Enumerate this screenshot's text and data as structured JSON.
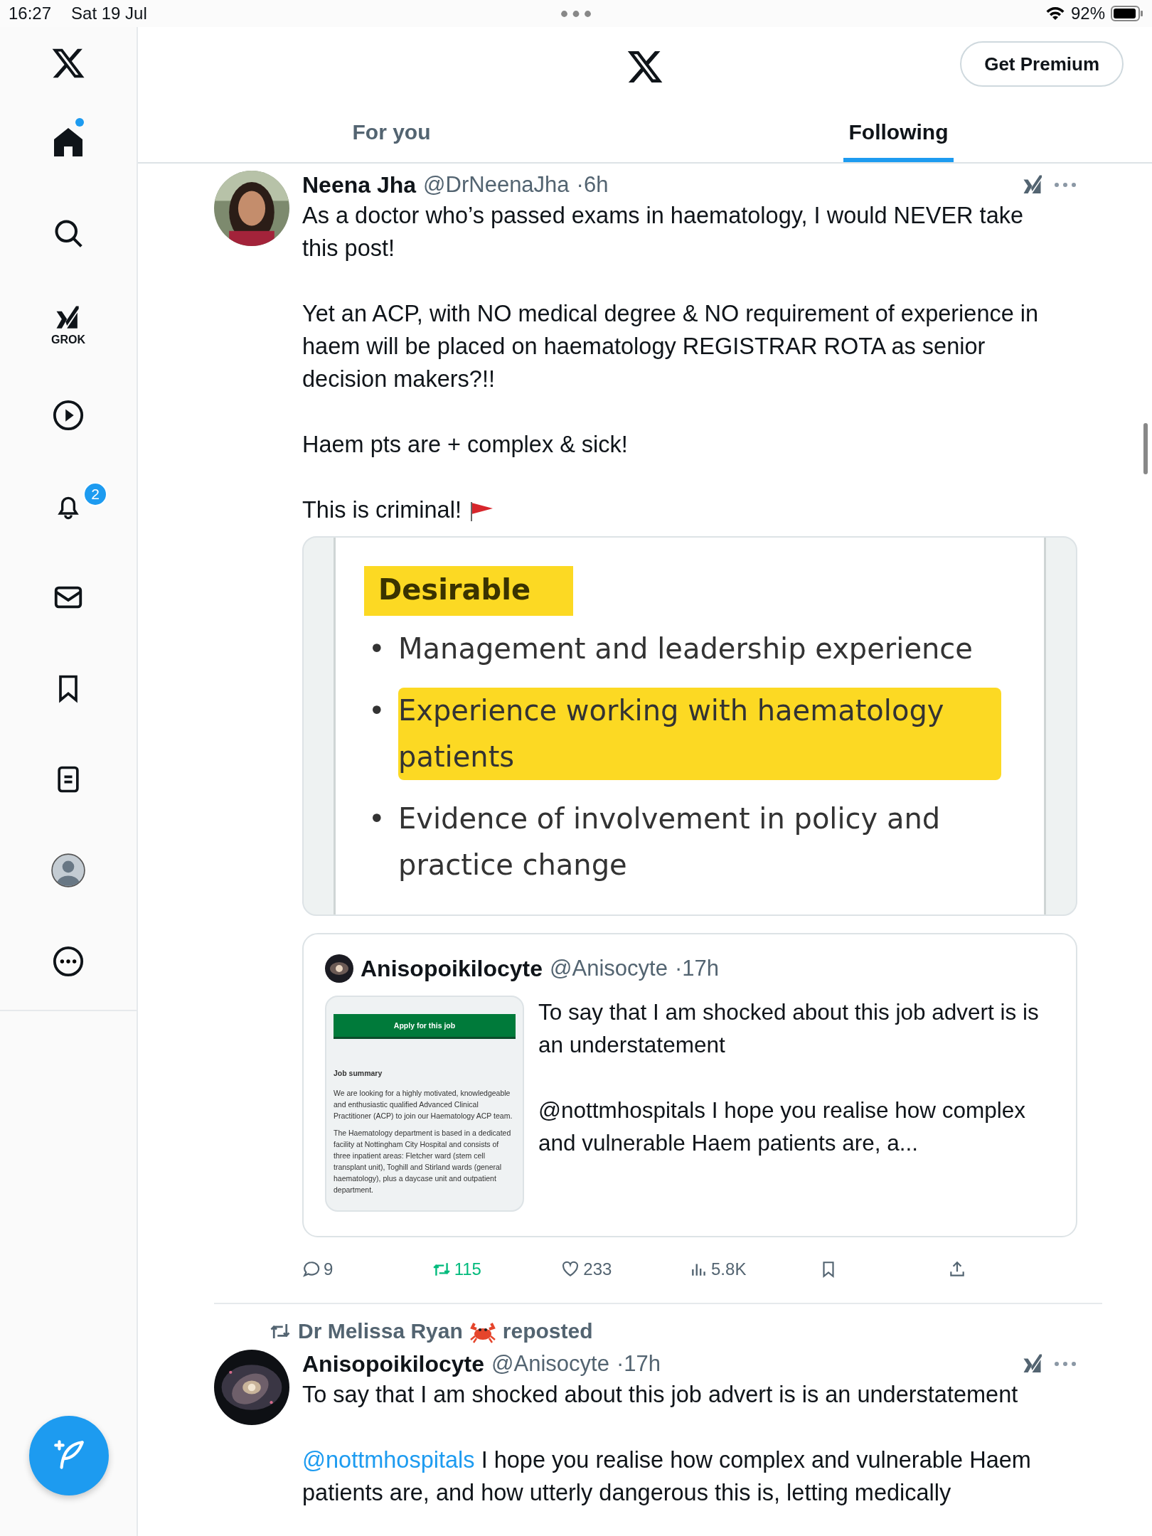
{
  "status_bar": {
    "time": "16:27",
    "date": "Sat 19 Jul",
    "battery": "92%"
  },
  "sidebar": {
    "items": [
      {
        "kind": "home",
        "selected": true,
        "has_new": true
      },
      {
        "kind": "search",
        "selected": false
      },
      {
        "kind": "grok",
        "selected": false,
        "label": "GROK"
      },
      {
        "kind": "video",
        "selected": false
      },
      {
        "kind": "notifications",
        "selected": false,
        "badge": "2"
      },
      {
        "kind": "messages",
        "selected": false
      },
      {
        "kind": "bookmarks",
        "selected": false
      },
      {
        "kind": "lists",
        "selected": false
      },
      {
        "kind": "profile",
        "selected": false
      },
      {
        "kind": "more",
        "selected": false
      }
    ]
  },
  "header": {
    "premium_button": "Get Premium"
  },
  "tabs": [
    {
      "label": "For you",
      "selected": false
    },
    {
      "label": "Following",
      "selected": true
    }
  ],
  "posts": [
    {
      "author": "Neena Jha",
      "handle": "@DrNeenaJha",
      "time": "·6h",
      "paragraphs": [
        "As a doctor who’s passed exams in haematology, I would NEVER take this post!",
        "Yet an ACP, with NO medical degree & NO requirement of experience in haem will be placed on haematology REGISTRAR ROTA as senior decision makers?!!",
        "Haem pts are + complex & sick!",
        "This is criminal!"
      ],
      "document": {
        "heading": "Desirable",
        "bullets": [
          {
            "marker": "•",
            "text": "Management and leadership experience",
            "highlighted": false
          },
          {
            "marker": "•",
            "text": "Experience working with haematology patients",
            "highlighted": true
          },
          {
            "marker": "•",
            "text": "Evidence of involvement in policy and practice change",
            "highlighted": false
          }
        ]
      },
      "quote": {
        "author": "Anisopoikilocyte",
        "handle": "@Anisocyte",
        "time": "·17h",
        "thumbnail": {
          "button": "Apply for this job",
          "heading": "Job summary",
          "paragraphs": [
            "We are looking for a highly motivated, knowledgeable and enthusiastic qualified Advanced Clinical Practitioner (ACP) to join our Haematology ACP team.",
            "The Haematology department is based in a dedicated facility at Nottingham City Hospital and consists of three inpatient areas: Fletcher ward (stem cell transplant unit), Toghill and Stirland wards (general haematology), plus a daycase unit and outpatient department."
          ]
        },
        "paragraphs": [
          "To say that I am shocked about this job advert is is an understatement",
          "@nottmhospitals I hope you realise how complex and vulnerable Haem patients are, a..."
        ]
      },
      "actions": [
        {
          "kind": "reply",
          "count": "9",
          "active": false
        },
        {
          "kind": "repost",
          "count": "115",
          "active": true
        },
        {
          "kind": "like",
          "count": "233",
          "active": false
        },
        {
          "kind": "views",
          "count": "5.8K",
          "active": false
        },
        {
          "kind": "bookmark",
          "active": false
        },
        {
          "kind": "share"
        }
      ]
    }
  ],
  "repost": {
    "reposter": "Dr Melissa Ryan",
    "label": "reposted",
    "author": "Anisopoikilocyte",
    "handle": "@Anisocyte",
    "time": "·17h",
    "paragraphs": [
      {
        "text": "To say that I am shocked about this job advert is is an understatement"
      },
      {
        "mention": "@nottmhospitals",
        "text": "I hope you realise how complex and vulnerable Haem patients are, and how utterly dangerous this is, letting medically"
      }
    ]
  }
}
